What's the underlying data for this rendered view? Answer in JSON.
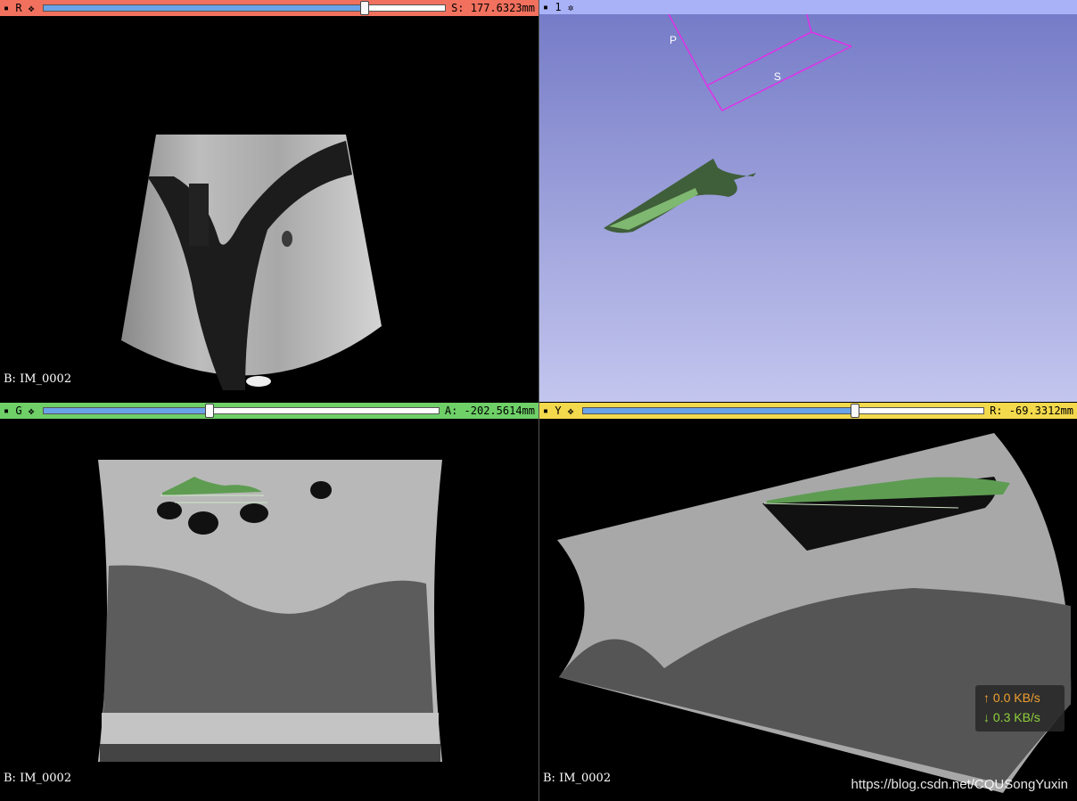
{
  "views": {
    "red": {
      "letter": "R",
      "offset_text": "S: 177.6323mm",
      "slider_value": 0.8,
      "volume_label": "B: IM_0002",
      "bar_color": "#f1715e"
    },
    "threed": {
      "letter": "1",
      "axis_labels": [
        "P",
        "S"
      ],
      "bar_color": "#a9b2f7"
    },
    "green": {
      "letter": "G",
      "offset_text": "A: -202.5614mm",
      "slider_value": 0.42,
      "volume_label": "B: IM_0002",
      "bar_color": "#6ed067"
    },
    "yellow": {
      "letter": "Y",
      "offset_text": "R: -69.3312mm",
      "slider_value": 0.68,
      "volume_label": "B: IM_0002",
      "bar_color": "#f3d94c"
    }
  },
  "icons": {
    "pin": "pin-icon",
    "link": "link-icon",
    "gear": "gear-icon"
  },
  "network": {
    "up": "↑ 0.0 KB/s",
    "down": "↓ 0.3 KB/s",
    "up_color": "#f0a030",
    "down_color": "#8fd03c"
  },
  "watermark": "https://blog.csdn.net/CQUSongYuxin"
}
